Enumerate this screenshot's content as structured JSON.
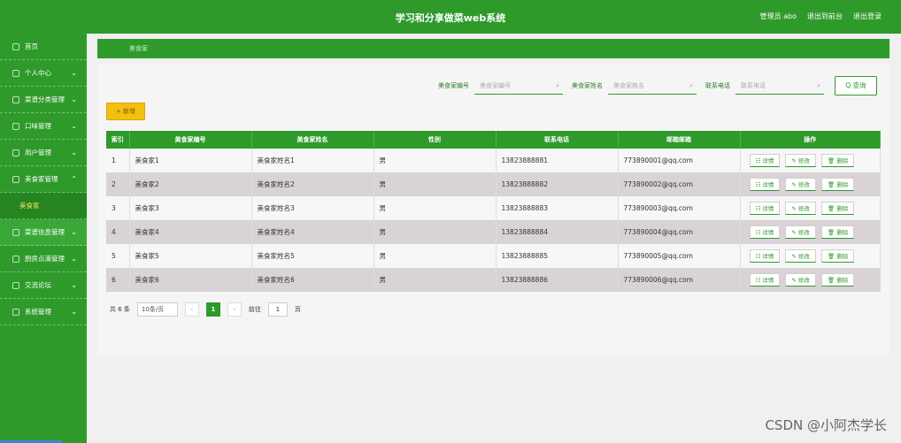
{
  "header": {
    "title": "学习和分享做菜web系统",
    "admin": "管理员 abo",
    "back": "退出到前台",
    "logout": "退出登录"
  },
  "sidebar": {
    "items": [
      {
        "label": "首页",
        "chev": ""
      },
      {
        "label": "个人中心",
        "chev": "⌄"
      },
      {
        "label": "菜谱分类管理",
        "chev": "⌄"
      },
      {
        "label": "口味管理",
        "chev": "⌄"
      },
      {
        "label": "用户管理",
        "chev": "⌄"
      },
      {
        "label": "美食家管理",
        "chev": "⌃"
      },
      {
        "label": "美食家",
        "chev": ""
      },
      {
        "label": "菜谱信息管理",
        "chev": "⌄"
      },
      {
        "label": "厨房点滴管理",
        "chev": "⌄"
      },
      {
        "label": "交流论坛",
        "chev": "⌄"
      },
      {
        "label": "系统管理",
        "chev": "⌄"
      }
    ]
  },
  "breadcrumb": "美食家",
  "search": {
    "label1": "美食家编号",
    "ph1": "美食家编号",
    "label2": "美食家姓名",
    "ph2": "美食家姓名",
    "label3": "联系电话",
    "ph3": "联系电话",
    "button": "Q 查询"
  },
  "add_button": "+ 新增",
  "table": {
    "headers": [
      "索引",
      "美食家编号",
      "美食家姓名",
      "性别",
      "联系电话",
      "邮箱邮箱",
      "操作"
    ],
    "rows": [
      {
        "idx": "1",
        "code": "美食家1",
        "name": "美食家姓名1",
        "sex": "男",
        "phone": "13823888881",
        "email": "773890001@qq.com"
      },
      {
        "idx": "2",
        "code": "美食家2",
        "name": "美食家姓名2",
        "sex": "男",
        "phone": "13823888882",
        "email": "773890002@qq.com"
      },
      {
        "idx": "3",
        "code": "美食家3",
        "name": "美食家姓名3",
        "sex": "男",
        "phone": "13823888883",
        "email": "773890003@qq.com"
      },
      {
        "idx": "4",
        "code": "美食家4",
        "name": "美食家姓名4",
        "sex": "男",
        "phone": "13823888884",
        "email": "773890004@qq.com"
      },
      {
        "idx": "5",
        "code": "美食家5",
        "name": "美食家姓名5",
        "sex": "男",
        "phone": "13823888885",
        "email": "773890005@qq.com"
      },
      {
        "idx": "6",
        "code": "美食家6",
        "name": "美食家姓名6",
        "sex": "男",
        "phone": "13823888886",
        "email": "773890006@qq.com"
      }
    ],
    "ops": [
      "详情",
      "修改",
      "删除"
    ]
  },
  "pager": {
    "total": "共 6 条",
    "per_page": "10条/页",
    "current": "1",
    "goto": "前往",
    "page_input": "1",
    "page_unit": "页"
  },
  "watermark": "CSDN @小阿杰学长",
  "colors": {
    "primary": "#2e9a2a",
    "add": "#f2c010"
  }
}
